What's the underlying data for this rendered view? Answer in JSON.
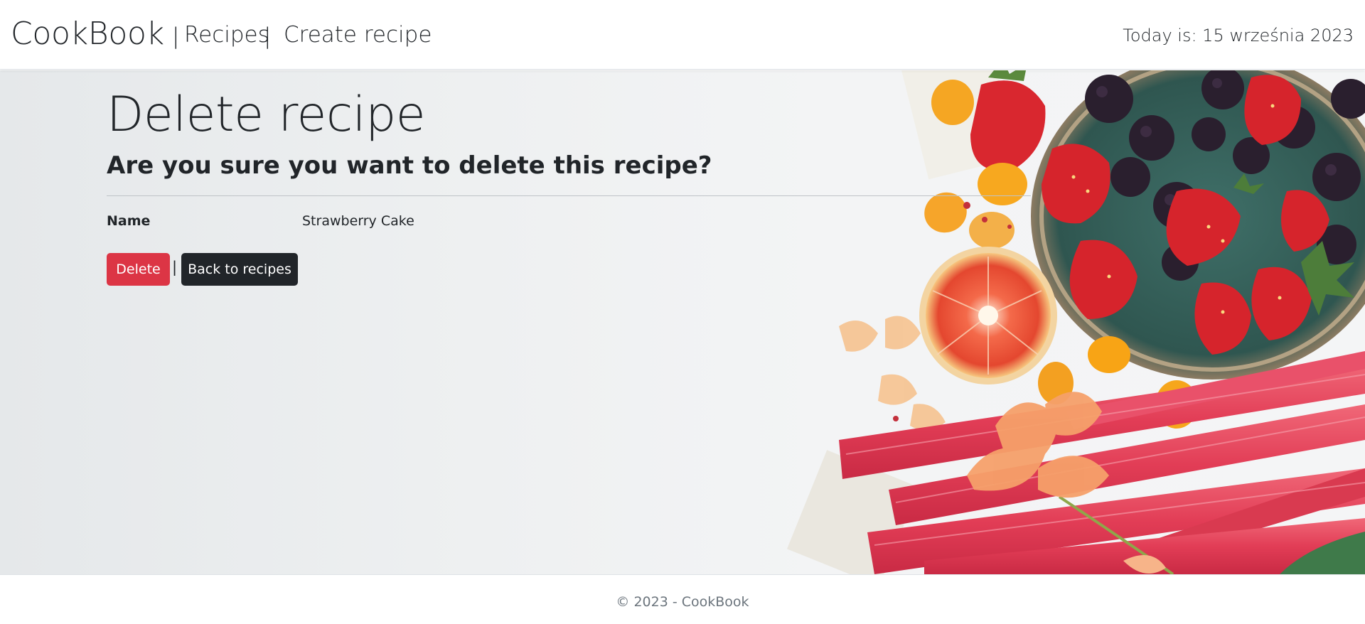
{
  "header": {
    "brand": "CookBook",
    "sep_left": "|",
    "sep_right": "|",
    "nav": [
      {
        "label": "Recipes"
      },
      {
        "label": "Create recipe"
      }
    ],
    "today": "Today is: 15 września 2023"
  },
  "main": {
    "title": "Delete recipe",
    "subtitle": "Are you sure you want to delete this recipe?",
    "details": [
      {
        "label": "Name",
        "value": "Strawberry Cake"
      }
    ],
    "delete_label": "Delete",
    "separator": "|",
    "back_label": "Back to recipes"
  },
  "footer": {
    "text": "© 2023 - CookBook"
  },
  "colors": {
    "danger": "#dc3545",
    "dark": "#212529",
    "muted": "#6c757d"
  }
}
